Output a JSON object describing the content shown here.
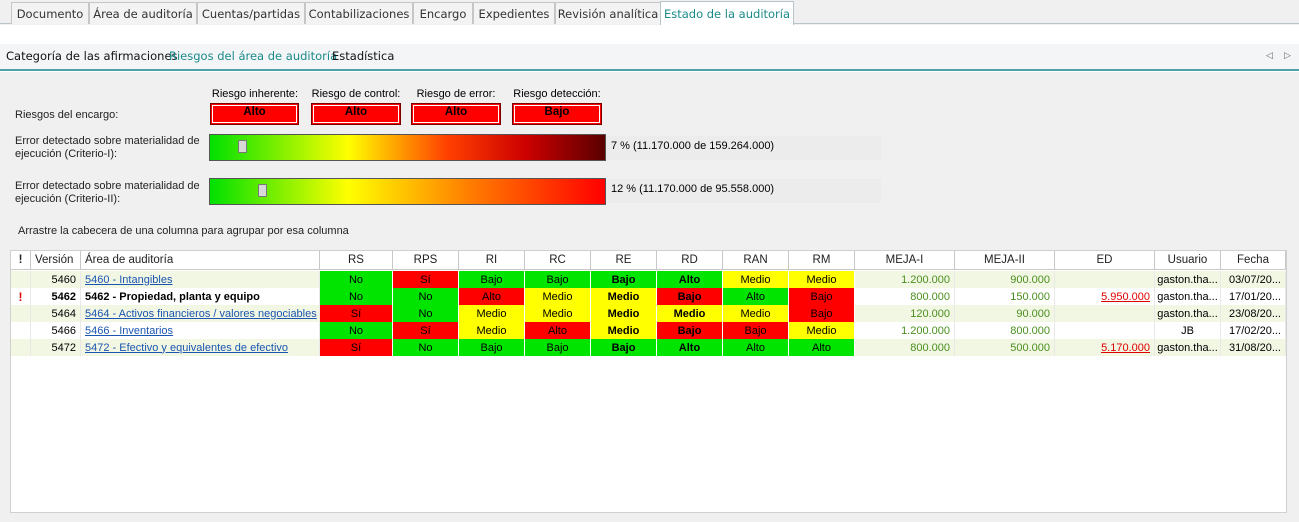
{
  "top_tabs": [
    "Documento",
    "Área de auditoría",
    "Cuentas/partidas",
    "Contabilizaciones",
    "Encargo",
    "Expedientes",
    "Revisión analítica",
    "Estado de la auditoría"
  ],
  "sub_tabs": [
    "Categoría de las afirmaciones",
    "Riesgos del área de auditoría",
    "Estadística"
  ],
  "nav": {
    "prev": "◁",
    "next": "▷"
  },
  "risks": {
    "label": "Riesgos del encargo:",
    "items": [
      {
        "head": "Riesgo inherente:",
        "value": "Alto"
      },
      {
        "head": "Riesgo de control:",
        "value": "Alto"
      },
      {
        "head": "Riesgo de error:",
        "value": "Alto"
      },
      {
        "head": "Riesgo detección:",
        "value": "Bajo"
      }
    ]
  },
  "gauges": [
    {
      "label1": "Error detectado sobre materialidad de",
      "label2": "ejecución (Criterio-I):",
      "text": "7 % (11.170.000 de 159.264.000)",
      "level": 0.07
    },
    {
      "label1": "Error detectado sobre materialidad de",
      "label2": "ejecución (Criterio-II):",
      "text": "12 % (11.170.000 de 95.558.000)",
      "level": 0.12
    }
  ],
  "group_hint": "Arrastre la cabecera de una columna para agrupar por esa columna",
  "colors": {
    "green": "#00e400",
    "red": "#ff0000",
    "yellow": "#ffff00",
    "row_alt": "#f2f7e4"
  },
  "columns": [
    "!",
    "Versión",
    "Área de auditoría",
    "RS",
    "RPS",
    "RI",
    "RC",
    "RE",
    "RD",
    "RAN",
    "RM",
    "MEJA-I",
    "MEJA-II",
    "ED",
    "Usuario",
    "Fecha"
  ],
  "rows": [
    {
      "flag": "",
      "version": "5460",
      "area": "5460 - Intangibles",
      "bold": false,
      "risks": [
        [
          "No",
          "g"
        ],
        [
          "Sí",
          "r"
        ],
        [
          "Bajo",
          "g"
        ],
        [
          "Bajo",
          "g"
        ],
        [
          "Bajo",
          "g"
        ],
        [
          "Alto",
          "g"
        ],
        [
          "Medio",
          "y"
        ],
        [
          "Medio",
          "y"
        ]
      ],
      "meja1": "1.200.000",
      "meja2": "900.000",
      "ed": "",
      "user": "gaston.tha...",
      "date": "03/07/20..."
    },
    {
      "flag": "!",
      "version": "5462",
      "area": "5462 - Propiedad, planta y equipo",
      "bold": true,
      "risks": [
        [
          "No",
          "g"
        ],
        [
          "No",
          "g"
        ],
        [
          "Alto",
          "r"
        ],
        [
          "Medio",
          "y"
        ],
        [
          "Medio",
          "y"
        ],
        [
          "Bajo",
          "r"
        ],
        [
          "Alto",
          "g"
        ],
        [
          "Bajo",
          "r"
        ]
      ],
      "meja1": "800.000",
      "meja2": "150.000",
      "ed": "5.950.000",
      "user": "gaston.tha...",
      "date": "17/01/20..."
    },
    {
      "flag": "",
      "version": "5464",
      "area": "5464 - Activos financieros / valores negociables",
      "bold": false,
      "risks": [
        [
          "Sí",
          "r"
        ],
        [
          "No",
          "g"
        ],
        [
          "Medio",
          "y"
        ],
        [
          "Medio",
          "y"
        ],
        [
          "Medio",
          "y"
        ],
        [
          "Medio",
          "y"
        ],
        [
          "Medio",
          "y"
        ],
        [
          "Bajo",
          "r"
        ]
      ],
      "meja1": "120.000",
      "meja2": "90.000",
      "ed": "",
      "user": "gaston.tha...",
      "date": "23/08/20..."
    },
    {
      "flag": "",
      "version": "5466",
      "area": "5466 - Inventarios",
      "bold": false,
      "risks": [
        [
          "No",
          "g"
        ],
        [
          "Sí",
          "r"
        ],
        [
          "Medio",
          "y"
        ],
        [
          "Alto",
          "r"
        ],
        [
          "Medio",
          "y"
        ],
        [
          "Bajo",
          "r"
        ],
        [
          "Bajo",
          "r"
        ],
        [
          "Medio",
          "y"
        ]
      ],
      "meja1": "1.200.000",
      "meja2": "800.000",
      "ed": "",
      "user": "JB",
      "date": "17/02/20..."
    },
    {
      "flag": "",
      "version": "5472",
      "area": "5472 - Efectivo y equivalentes de efectivo",
      "bold": false,
      "risks": [
        [
          "Sí",
          "r"
        ],
        [
          "No",
          "g"
        ],
        [
          "Bajo",
          "g"
        ],
        [
          "Bajo",
          "g"
        ],
        [
          "Bajo",
          "g"
        ],
        [
          "Alto",
          "g"
        ],
        [
          "Alto",
          "g"
        ],
        [
          "Alto",
          "g"
        ]
      ],
      "meja1": "800.000",
      "meja2": "500.000",
      "ed": "5.170.000",
      "user": "gaston.tha...",
      "date": "31/08/20..."
    }
  ]
}
